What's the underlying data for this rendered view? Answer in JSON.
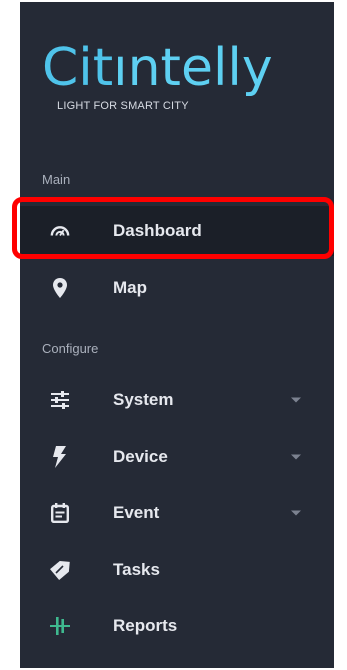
{
  "logo": {
    "wordmark_colored": "Cit",
    "wordmark_rest": "ıntelly",
    "tagline": "LIGHT FOR SMART CITY",
    "color": "#4fc3ea"
  },
  "sections": {
    "main": "Main",
    "configure": "Configure"
  },
  "menu": {
    "dashboard": {
      "label": "Dashboard",
      "icon": "speedometer-icon",
      "active": true
    },
    "map": {
      "label": "Map",
      "icon": "map-pin-icon"
    },
    "system": {
      "label": "System",
      "icon": "sliders-icon",
      "expandable": true
    },
    "device": {
      "label": "Device",
      "icon": "lightning-icon",
      "expandable": true
    },
    "event": {
      "label": "Event",
      "icon": "calendar-icon",
      "expandable": true
    },
    "tasks": {
      "label": "Tasks",
      "icon": "tag-icon"
    },
    "reports": {
      "label": "Reports",
      "icon": "chart-bars-icon"
    }
  },
  "colors": {
    "sidebar_bg": "#252a36",
    "text": "#e6e8ee",
    "muted": "#aab0bc",
    "accent": "#4fc3ea",
    "highlight": "#ff0000"
  }
}
